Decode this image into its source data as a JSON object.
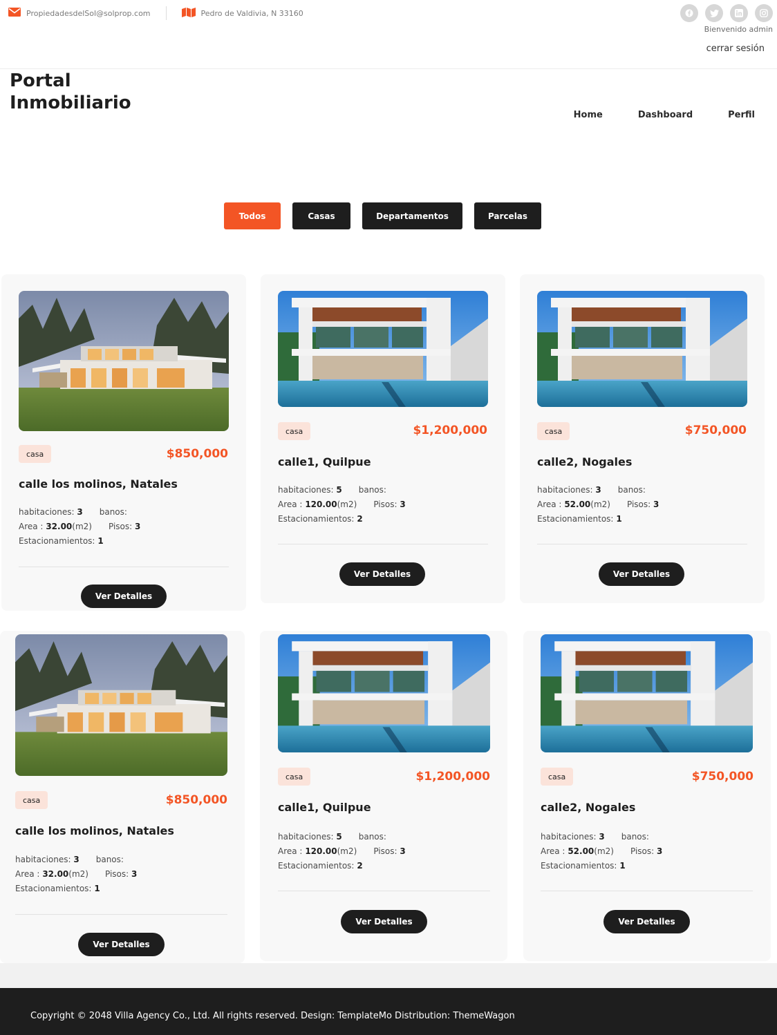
{
  "topbar": {
    "email": "PropiedadesdelSol@solprop.com",
    "address": "Pedro de Valdivia, N 33160",
    "welcome": "Bienvenido admin",
    "logout": "cerrar sesión"
  },
  "header": {
    "brand_line1": "Portal",
    "brand_line2": "Inmobiliario",
    "nav": [
      "Home",
      "Dashboard",
      "Perfil"
    ]
  },
  "filters": [
    "Todos",
    "Casas",
    "Departamentos",
    "Parcelas"
  ],
  "labels": {
    "habitaciones": "habitaciones:",
    "banos": "banos:",
    "area": "Area :",
    "area_unit": "(m2)",
    "pisos": "Pisos:",
    "estacionamientos": "Estacionamientos:",
    "details_button": "Ver Detalles"
  },
  "cards": [
    {
      "type": "casa",
      "price": "$850,000",
      "address": "calle los molinos, Natales",
      "habitaciones": "3",
      "area": "32.00",
      "pisos": "3",
      "estacionamientos": "1"
    },
    {
      "type": "casa",
      "price": "$1,200,000",
      "address": "calle1, Quilpue",
      "habitaciones": "5",
      "area": "120.00",
      "pisos": "3",
      "estacionamientos": "2"
    },
    {
      "type": "casa",
      "price": "$750,000",
      "address": "calle2, Nogales",
      "habitaciones": "3",
      "area": "52.00",
      "pisos": "3",
      "estacionamientos": "1"
    },
    {
      "type": "casa",
      "price": "$850,000",
      "address": "calle los molinos, Natales",
      "habitaciones": "3",
      "area": "32.00",
      "pisos": "3",
      "estacionamientos": "1"
    },
    {
      "type": "casa",
      "price": "$1,200,000",
      "address": "calle1, Quilpue",
      "habitaciones": "5",
      "area": "120.00",
      "pisos": "3",
      "estacionamientos": "2"
    },
    {
      "type": "casa",
      "price": "$750,000",
      "address": "calle2, Nogales",
      "habitaciones": "3",
      "area": "52.00",
      "pisos": "3",
      "estacionamientos": "1"
    }
  ],
  "footer": {
    "copyright": "Copyright © 2048 Villa Agency Co., Ltd. All rights reserved. Design: TemplateMo Distribution: ThemeWagon"
  },
  "colors": {
    "accent": "#f35525",
    "dark": "#1e1e1e",
    "tag_bg": "#fbe3da",
    "card_bg": "#f8f8f8"
  },
  "icons": [
    "envelope-icon",
    "map-icon",
    "facebook-icon",
    "twitter-icon",
    "linkedin-icon",
    "instagram-icon"
  ]
}
